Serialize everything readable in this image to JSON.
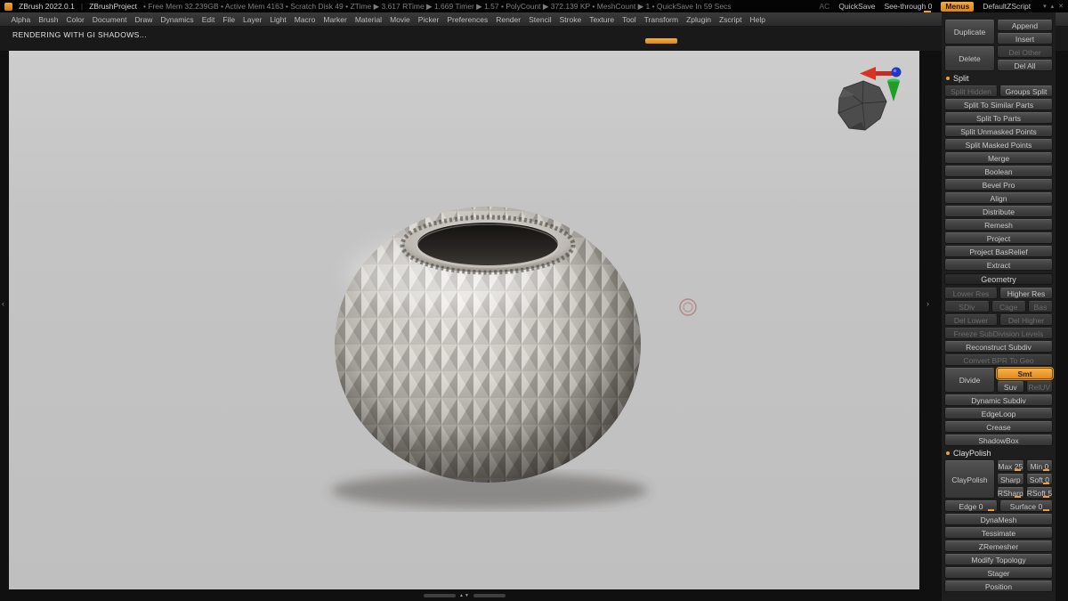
{
  "titlebar": {
    "app": "ZBrush 2022.0.1",
    "project": "ZBrushProject",
    "separator": "|",
    "stats": "• Free Mem 32.239GB  • Active Mem 4163  • Scratch Disk 49  • ZTime ▶ 3.617  RTime ▶ 1.669  Timer ▶ 1.57  • PolyCount ▶ 372.139 KP  • MeshCount ▶ 1  • QuickSave In 59 Secs",
    "ac": "AC",
    "quicksave": "QuickSave",
    "see_through": "See-through 0",
    "menus": "Menus",
    "default_zscript": "DefaultZScript"
  },
  "menubar": {
    "items": [
      "Alpha",
      "Brush",
      "Color",
      "Document",
      "Draw",
      "Dynamics",
      "Edit",
      "File",
      "Layer",
      "Light",
      "Macro",
      "Marker",
      "Material",
      "Movie",
      "Picker",
      "Preferences",
      "Render",
      "Stencil",
      "Stroke",
      "Texture",
      "Tool",
      "Transform",
      "Zplugin",
      "Zscript",
      "Help"
    ],
    "active": "Transform"
  },
  "status": "RENDERING WITH GI SHADOWS...",
  "colors": {
    "accent": "#f0a030",
    "canvas": "#c3c3c3"
  },
  "icons": {
    "minimize": "▾",
    "restore": "▴",
    "close": "✕",
    "scroll_arrows": "▲▼",
    "left_edge_arrow": "‹",
    "right_edge_arrow": "›"
  },
  "panel": {
    "duplicate": "Duplicate",
    "append": "Append",
    "insert": "Insert",
    "delete": "Delete",
    "del_other": "Del Other",
    "del_all": "Del All",
    "split_hdr": "Split",
    "split_hidden": "Split Hidden",
    "groups_split": "Groups Split",
    "split_similar": "Split To Similar Parts",
    "split_parts": "Split To Parts",
    "split_unmasked": "Split Unmasked Points",
    "split_masked": "Split Masked Points",
    "merge": "Merge",
    "boolean": "Boolean",
    "bevel_pro": "Bevel Pro",
    "align": "Align",
    "distribute": "Distribute",
    "remesh": "Remesh",
    "project": "Project",
    "project_basrelief": "Project BasRelief",
    "extract": "Extract",
    "geometry_hdr": "Geometry",
    "lower_res": "Lower Res",
    "higher_res": "Higher Res",
    "sdiv": "SDiv",
    "cage": "Cage",
    "bas": "Bas",
    "del_lower": "Del Lower",
    "del_higher": "Del Higher",
    "freeze": "Freeze SubDivision Levels",
    "reconstruct": "Reconstruct Subdiv",
    "convert_bpr": "Convert BPR To Geo",
    "divide": "Divide",
    "smt": "Smt",
    "suv": "Suv",
    "reluv": "RelUV",
    "dynamic_subdiv": "Dynamic Subdiv",
    "edgeloop": "EdgeLoop",
    "crease": "Crease",
    "shadowbox": "ShadowBox",
    "claypolish_hdr": "ClayPolish",
    "claypolish": "ClayPolish",
    "max": "Max 25",
    "min": "Min 0",
    "sharp": "Sharp",
    "soft": "Soft 0",
    "rsharp": "RSharp",
    "rsoft": "RSoft 5",
    "edge": "Edge 0",
    "surface": "Surface 0",
    "dynamesh": "DynaMesh",
    "tessimate": "Tessimate",
    "zremesher": "ZRemesher",
    "modify_topology": "Modify Topology",
    "stager": "Stager",
    "position": "Position"
  }
}
